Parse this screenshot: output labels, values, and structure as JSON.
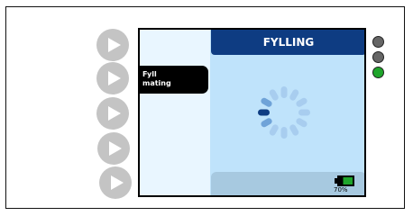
{
  "header": {
    "title": "FYLLING"
  },
  "menu": {
    "item_line1": "Fyll",
    "item_line2": "mating"
  },
  "status": {
    "battery_percent": "70%",
    "battery_level": 0.7,
    "battery_color": "#1fa52b"
  },
  "indicators": [
    {
      "name": "indicator-1",
      "color": "#666666"
    },
    {
      "name": "indicator-2",
      "color": "#666666"
    },
    {
      "name": "indicator-3",
      "color": "#1fa52b"
    }
  ],
  "side_buttons": [
    "play-icon",
    "play-icon",
    "play-icon",
    "play-icon",
    "play-icon"
  ]
}
